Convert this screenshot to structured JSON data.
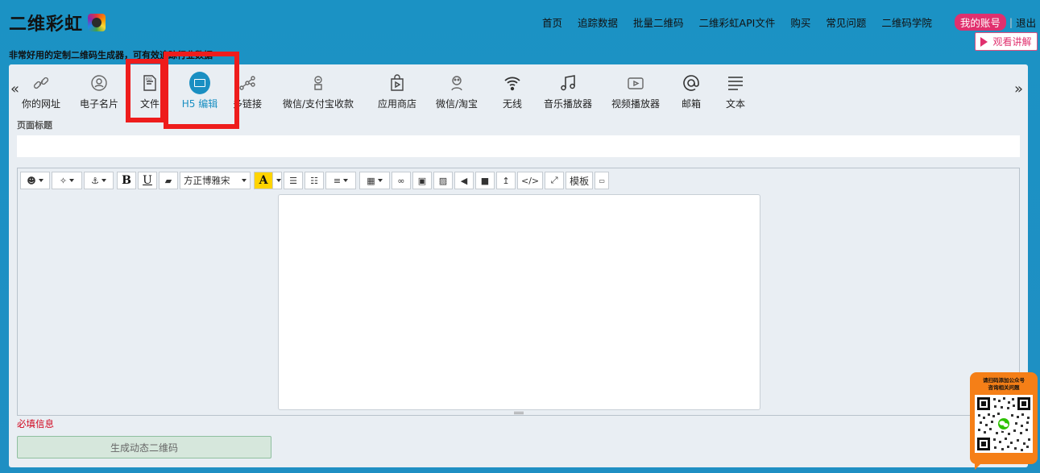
{
  "brand": {
    "name": "二维彩虹"
  },
  "nav": {
    "items": [
      "首页",
      "追踪数据",
      "批量二维码",
      "二维彩虹API文件",
      "购买",
      "常见问题",
      "二维码学院"
    ],
    "account": "我的账号",
    "separator": "|",
    "logout": "退出"
  },
  "watch_button": "观看讲解",
  "tagline": "非常好用的定制二维码生成器，可有效追踪行业数据",
  "carousel": {
    "prev": "«",
    "next": "»"
  },
  "code_types": [
    {
      "label": "你的网址",
      "icon": "link-icon"
    },
    {
      "label": "电子名片",
      "icon": "contact-card-icon"
    },
    {
      "label": "文件",
      "icon": "file-icon"
    },
    {
      "label": "H5 编辑",
      "icon": "html-icon",
      "active": true
    },
    {
      "label": "多链接",
      "icon": "multi-link-icon"
    },
    {
      "label": "微信/支付宝收款",
      "icon": "payment-icon"
    },
    {
      "label": "应用商店",
      "icon": "app-store-icon"
    },
    {
      "label": "微信/淘宝",
      "icon": "wechat-taobao-icon"
    },
    {
      "label": "无线",
      "icon": "wifi-icon"
    },
    {
      "label": "音乐播放器",
      "icon": "music-icon"
    },
    {
      "label": "视频播放器",
      "icon": "video-icon"
    },
    {
      "label": "邮箱",
      "icon": "email-icon"
    },
    {
      "label": "文本",
      "icon": "text-icon"
    }
  ],
  "form": {
    "page_title_label": "页面标题",
    "page_title_value": "",
    "required_note": "必填信息",
    "generate_button": "生成动态二维码"
  },
  "editor_toolbar": {
    "font_family": "方正博雅宋",
    "bold": "B",
    "underline": "U",
    "font_color": "A",
    "template": "模板",
    "code_view": "</>"
  },
  "qr_card": {
    "line1": "请扫码添加公众号",
    "line2": "咨询相关问题"
  },
  "colors": {
    "background": "#1f8fc3",
    "accent": "#1a8fc2",
    "account_badge": "#e0306e",
    "highlight_box": "#ee1c1c",
    "qr_card": "#f57f17"
  }
}
